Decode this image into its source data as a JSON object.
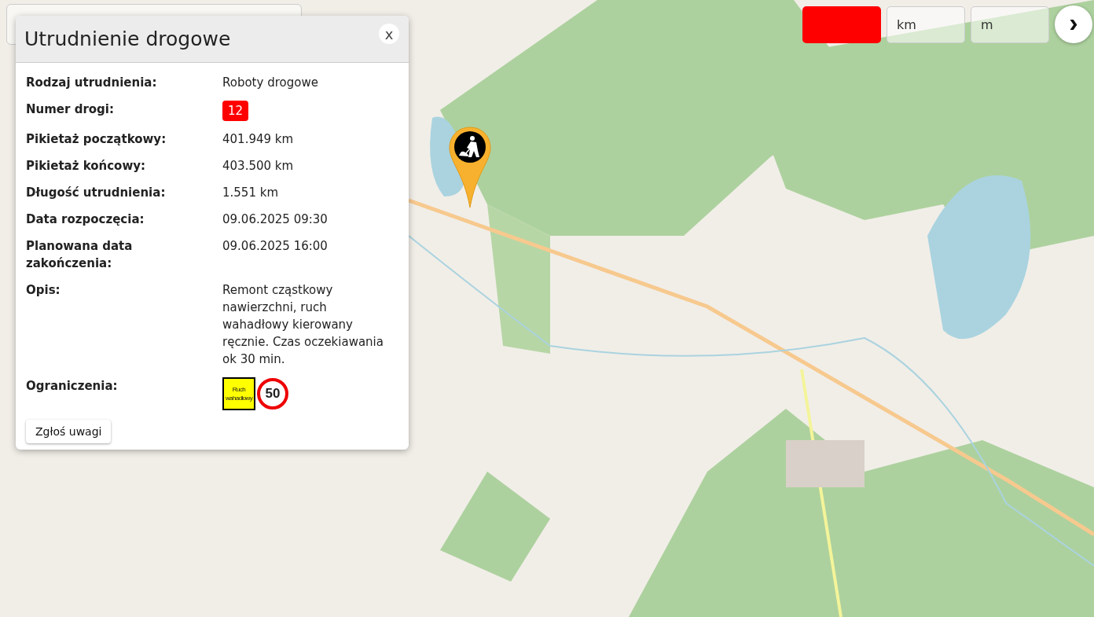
{
  "controls": {
    "road_field": {
      "kind": "color"
    },
    "km_field": {
      "placeholder": "km"
    },
    "m_field": {
      "placeholder": "m"
    },
    "next_button": {
      "label": "›"
    }
  },
  "popup": {
    "title": "Utrudnienie drogowe",
    "close_label": "x",
    "rows": [
      {
        "label": "Rodzaj utrudnienia:",
        "kind": "text",
        "value": "Roboty drogowe"
      },
      {
        "label": "Numer drogi:",
        "kind": "badge",
        "value": "12"
      },
      {
        "label": "Pikietaż początkowy:",
        "kind": "text",
        "value": "401.949 km"
      },
      {
        "label": "Pikietaż końcowy:",
        "kind": "text",
        "value": "403.500 km"
      },
      {
        "label": "Długość utrudnienia:",
        "kind": "text",
        "value": "1.551 km"
      },
      {
        "label": "Data rozpoczęcia:",
        "kind": "text",
        "value": "09.06.2025 09:30"
      },
      {
        "label": "Planowana data zakończenia:",
        "kind": "text",
        "value": "09.06.2025 16:00"
      },
      {
        "label": "Opis:",
        "kind": "text",
        "value": "Remont cząstkowy nawierzchni, ruch wahadłowy kierowany ręcznie. Czas oczekiawania ok 30 min."
      },
      {
        "label": "Ograniczenia:",
        "kind": "signs",
        "signs": [
          {
            "kind": "panel",
            "lines": [
              "Ruch",
              "wahadłowy"
            ]
          },
          {
            "kind": "speed",
            "text": "50"
          }
        ]
      }
    ],
    "report_button": "Zgłoś uwagi"
  }
}
